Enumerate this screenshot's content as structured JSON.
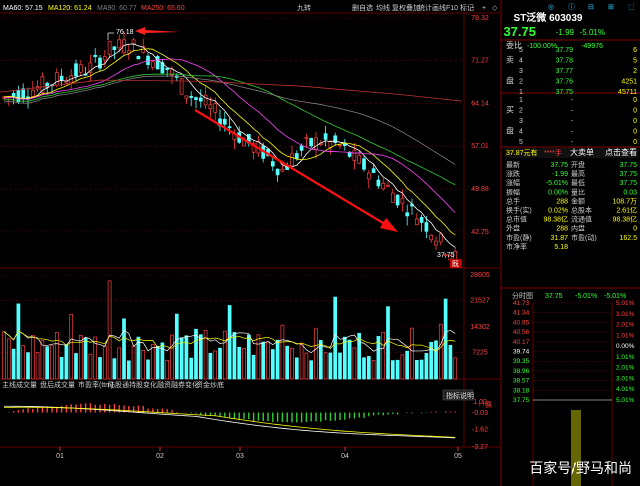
{
  "header": {
    "ma60": "MA60: 57.15",
    "ma120": "MA120: 61.24",
    "ma90": "MA90: 60.77",
    "ma250": "MA250: 65.60",
    "period": "九转",
    "tabs": [
      "删自选",
      "均线",
      "复权",
      "叠加",
      "统计",
      "画线",
      "F10",
      "标记",
      "-",
      "+",
      "◇"
    ]
  },
  "right_panel": {
    "toolbar": [
      "◎",
      "ⓘ",
      "⊟",
      "⊞",
      "⬚"
    ],
    "stock_title": "ST泛微 603039",
    "price": "37.75",
    "change": "-1.99",
    "change_pct": "-5.01%",
    "weibi_label": "委比",
    "weibi_val": "-100.00%",
    "weicha_val": "-49976",
    "asks": [
      {
        "label": "5",
        "side": "",
        "price": "37.79",
        "vol": "6"
      },
      {
        "label": "4",
        "side": "卖",
        "price": "37.78",
        "vol": "5"
      },
      {
        "label": "3",
        "side": "",
        "price": "37.77",
        "vol": "2"
      },
      {
        "label": "2",
        "side": "盘",
        "price": "37.76",
        "vol": "4251"
      },
      {
        "label": "1",
        "side": "",
        "price": "37.75",
        "vol": "45711"
      }
    ],
    "bids": [
      {
        "label": "1",
        "side": "",
        "price": "-",
        "vol": "0"
      },
      {
        "label": "2",
        "side": "买",
        "price": "-",
        "vol": "0"
      },
      {
        "label": "3",
        "side": "",
        "price": "-",
        "vol": "0"
      },
      {
        "label": "4",
        "side": "盘",
        "price": "-",
        "vol": "0"
      },
      {
        "label": "5",
        "side": "",
        "price": "-",
        "vol": "0"
      }
    ],
    "info_bar": {
      "price": "37.87元有",
      "stars": "****手",
      "big": "大卖单",
      "click": "点击查看"
    },
    "stats": [
      [
        "最新",
        "37.75",
        "开盘",
        "37.75"
      ],
      [
        "涨跌",
        "-1.99",
        "最高",
        "37.75"
      ],
      [
        "涨幅",
        "-5.01%",
        "最低",
        "37.75"
      ],
      [
        "振幅",
        "0.00%",
        "量比",
        "0.03"
      ],
      [
        "总手",
        "288",
        "金额",
        "108.7万"
      ],
      [
        "换手(实)",
        "0.02%",
        "总股本",
        "2.61亿"
      ],
      [
        "总市值",
        "98.38亿",
        "流通值",
        "98.38亿"
      ],
      [
        "外盘",
        "288",
        "内盘",
        "0"
      ],
      [
        "市盈(静)",
        "31.87",
        "市盈(动)",
        "162.5"
      ],
      [
        "市净率",
        "5.18",
        "",
        ""
      ]
    ],
    "intraday_header": {
      "label": "分时图",
      "price": "37.75",
      "pct": "-5.01%",
      "extra": "-5.01%"
    },
    "intraday_left": [
      "41.73",
      "41.34",
      "40.95",
      "40.56",
      "40.17",
      "39.74",
      "39.35",
      "38.96",
      "38.57",
      "38.18",
      "37.75"
    ],
    "intraday_right": [
      "5.01%",
      "3.01%",
      "2.01%",
      "1.01%",
      "0.00%",
      "1.01%",
      "2.01%",
      "3.01%",
      "4.01%",
      "5.01%"
    ]
  },
  "chart": {
    "price_axis": [
      "78.32",
      "71.27",
      "64.14",
      "57.01",
      "49.88",
      "42.75"
    ],
    "max_label": "76.18",
    "min_label": "37.75",
    "last_label": "既",
    "volume_axis": [
      "28605",
      "21527",
      "14302",
      "7225"
    ],
    "indicator_tabs": [
      "主线成交量",
      "盘后成交量",
      "市盈率(ttm)",
      "陆股通持股变化",
      "融资融券变化",
      "资金炒底"
    ],
    "indicator_button": "指标说明",
    "macd_label": "↑↑赛",
    "macd_axis": [
      "1.00",
      "-0.03",
      "-1.62",
      "-3.27"
    ],
    "date_labels": [
      "01",
      "02",
      "03",
      "04",
      "05"
    ]
  },
  "colors": {
    "up": "#ff4040",
    "down": "#54ffff",
    "ma_white": "#ffffff",
    "ma_yellow": "#ffff00",
    "ma_magenta": "#ff44ff",
    "ma_green": "#33cc33",
    "ma_gray": "#808080",
    "ma_red": "#c03030",
    "grid": "#600000"
  },
  "watermark": "百家号/野马和尚"
}
